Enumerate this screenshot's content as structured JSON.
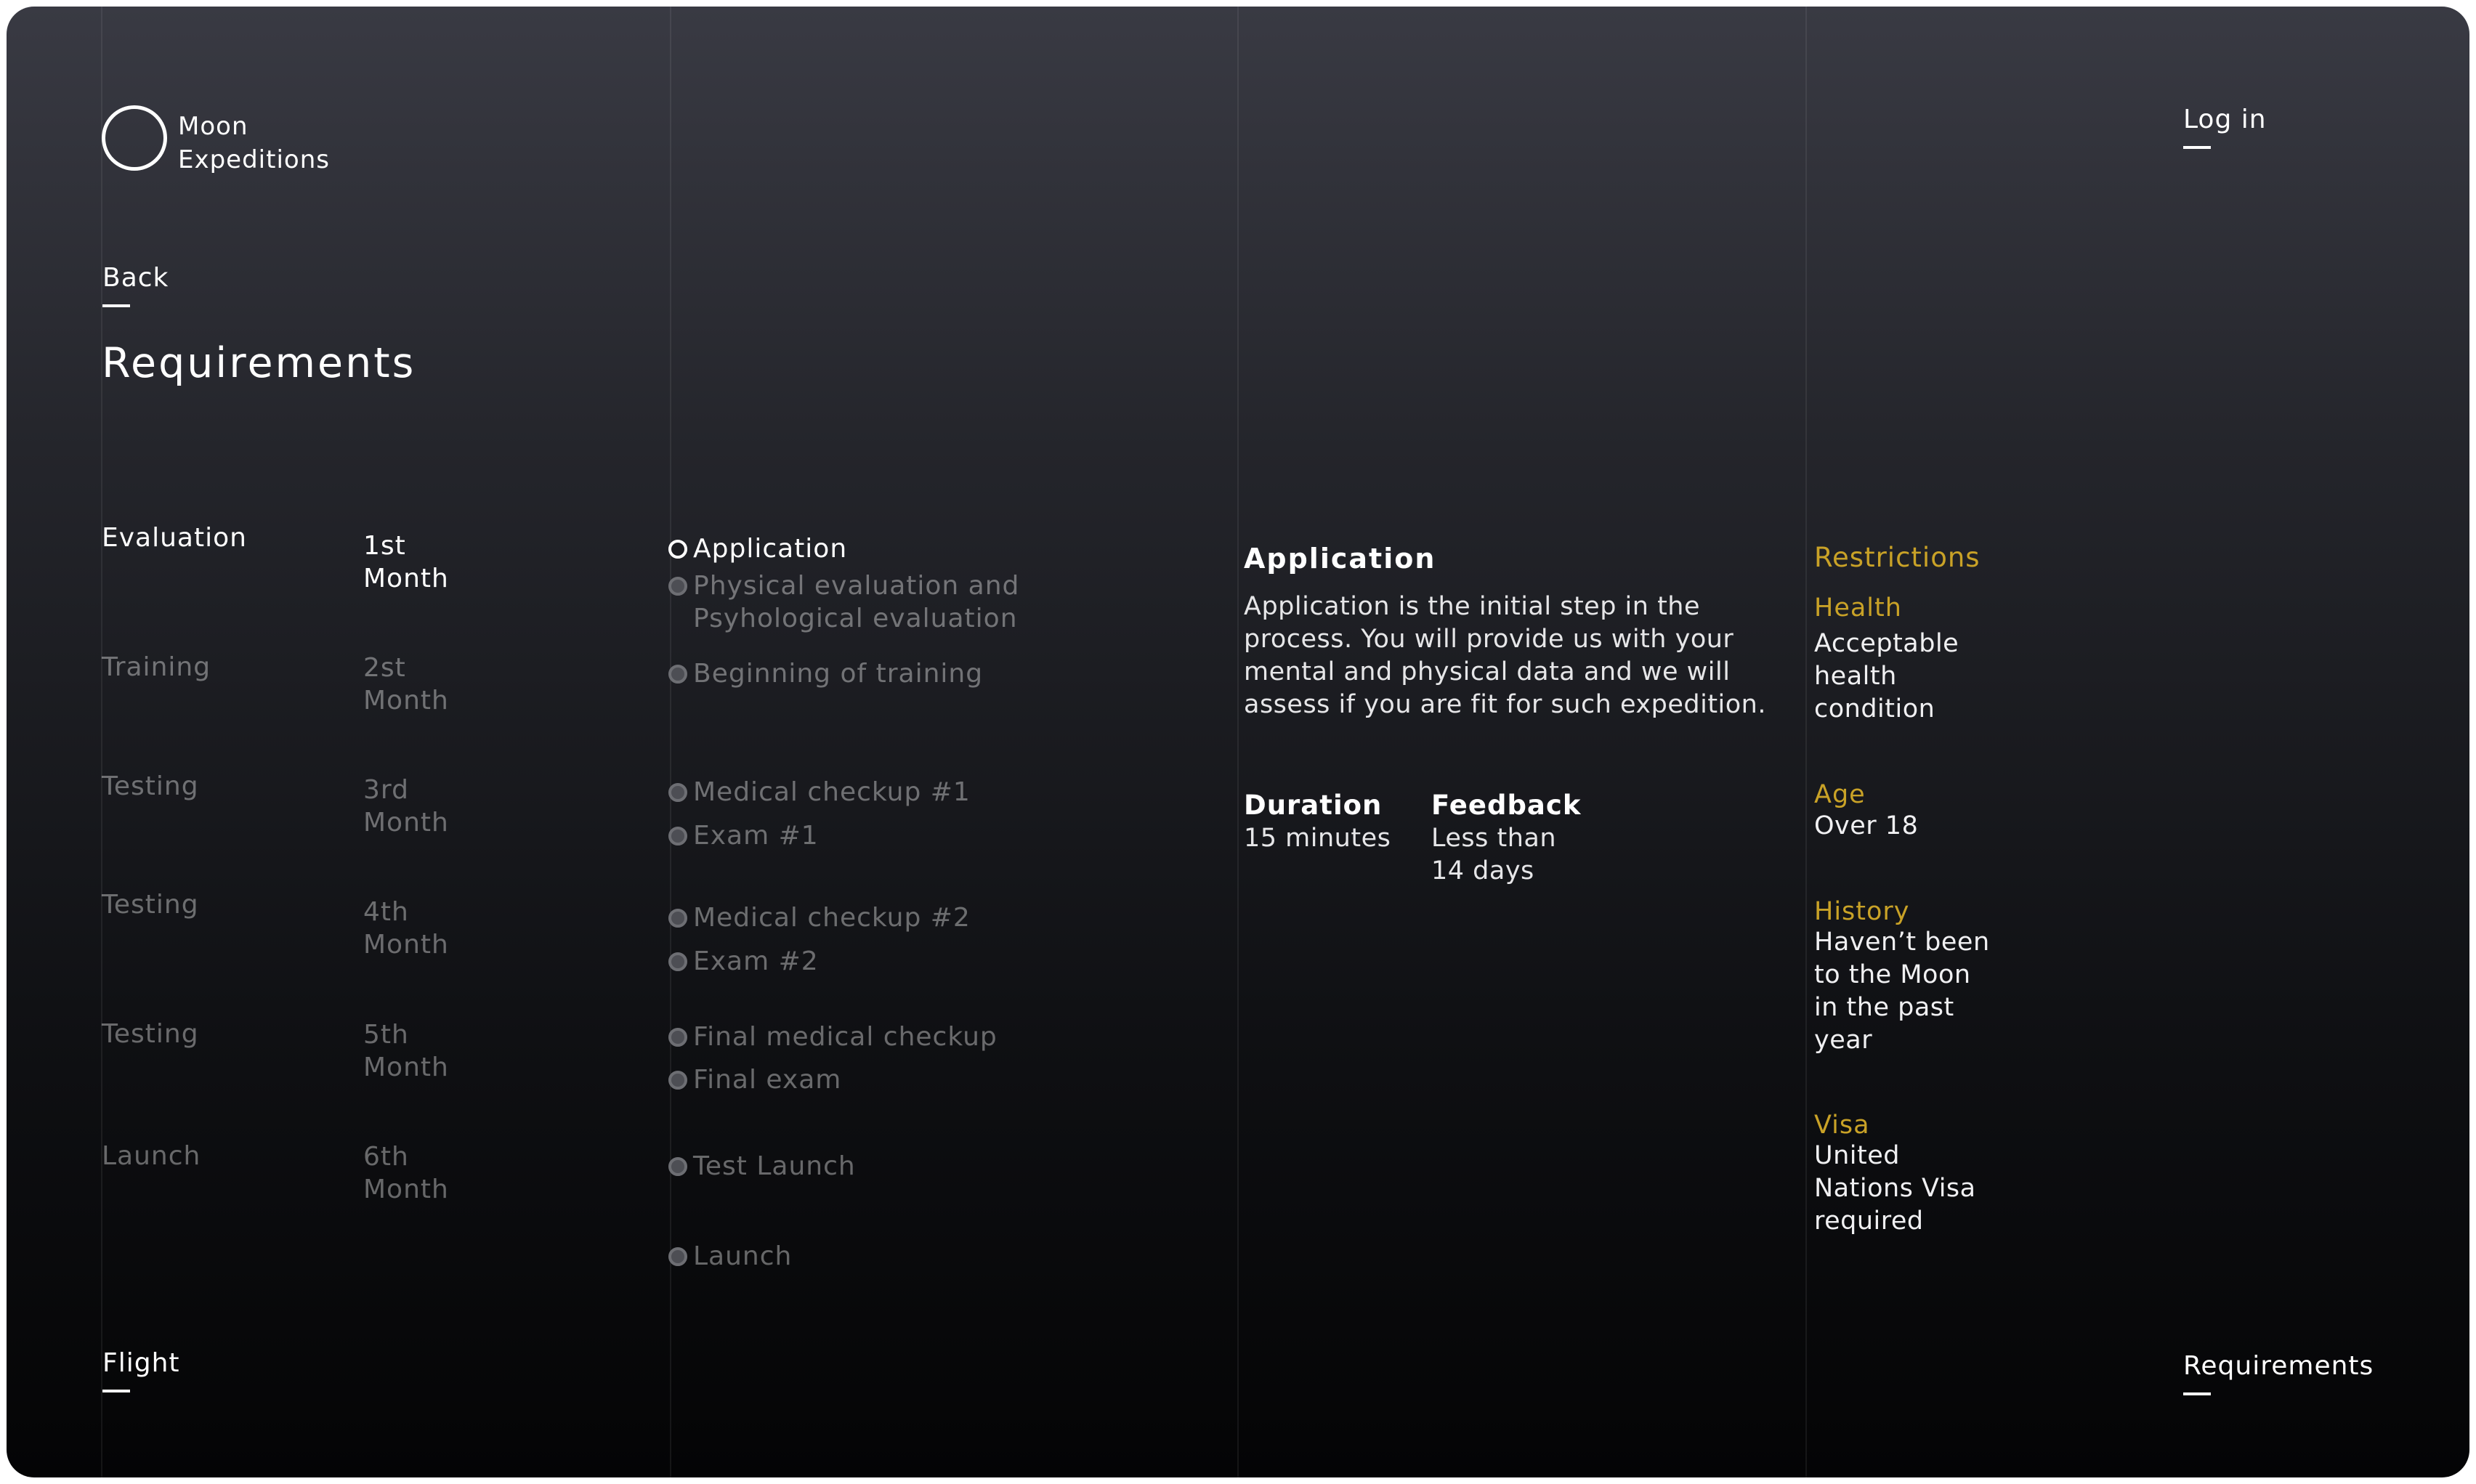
{
  "brand": {
    "line1": "Moon",
    "line2": "Expeditions"
  },
  "header": {
    "login_label": "Log in"
  },
  "nav": {
    "back_label": "Back",
    "flight_label": "Flight",
    "requirements_label": "Requirements"
  },
  "page": {
    "title": "Requirements"
  },
  "schedule": [
    {
      "phase": "Evaluation",
      "month_num": "1st",
      "month_word": "Month"
    },
    {
      "phase": "Training",
      "month_num": "2st",
      "month_word": "Month"
    },
    {
      "phase": "Testing",
      "month_num": "3rd",
      "month_word": "Month"
    },
    {
      "phase": "Testing",
      "month_num": "4th",
      "month_word": "Month"
    },
    {
      "phase": "Testing",
      "month_num": "5th",
      "month_word": "Month"
    },
    {
      "phase": "Launch",
      "month_num": "6th",
      "month_word": "Month"
    }
  ],
  "timeline": [
    {
      "label": "Application",
      "state": "active"
    },
    {
      "label": "Physical evaluation and",
      "label_line2": "Psyhological evaluation",
      "state": "inactive"
    },
    {
      "label": "Beginning of training",
      "state": "inactive"
    },
    {
      "label": "Medical checkup #1",
      "state": "inactive"
    },
    {
      "label": "Exam #1",
      "state": "inactive"
    },
    {
      "label": "Medical checkup #2",
      "state": "inactive"
    },
    {
      "label": "Exam #2",
      "state": "inactive"
    },
    {
      "label": "Final medical checkup",
      "state": "inactive"
    },
    {
      "label": "Final exam",
      "state": "inactive"
    },
    {
      "label": "Test Launch",
      "state": "inactive"
    },
    {
      "label": "Launch",
      "state": "inactive"
    }
  ],
  "detail": {
    "title": "Application",
    "body": "Application is the initial step in the process. You will provide us with your mental and physical data and we will assess if you are fit for such expedition.",
    "duration_label": "Duration",
    "duration_value": "15 minutes",
    "feedback_label": "Feedback",
    "feedback_value_line1": "Less than",
    "feedback_value_line2": "14 days"
  },
  "restrictions": {
    "title": "Restrictions",
    "items": [
      {
        "label": "Health",
        "value": "Acceptable health condition"
      },
      {
        "label": "Age",
        "value": "Over 18"
      },
      {
        "label": "History",
        "value": "Haven’t been to the Moon in the past year"
      },
      {
        "label": "Visa",
        "value": "United Nations Visa required"
      }
    ]
  },
  "colors": {
    "accent": "#c9a227",
    "text_primary": "#ffffff",
    "text_muted": "rgba(255,255,255,0.38)",
    "background_top": "#393a43",
    "background_bottom": "#040405"
  }
}
